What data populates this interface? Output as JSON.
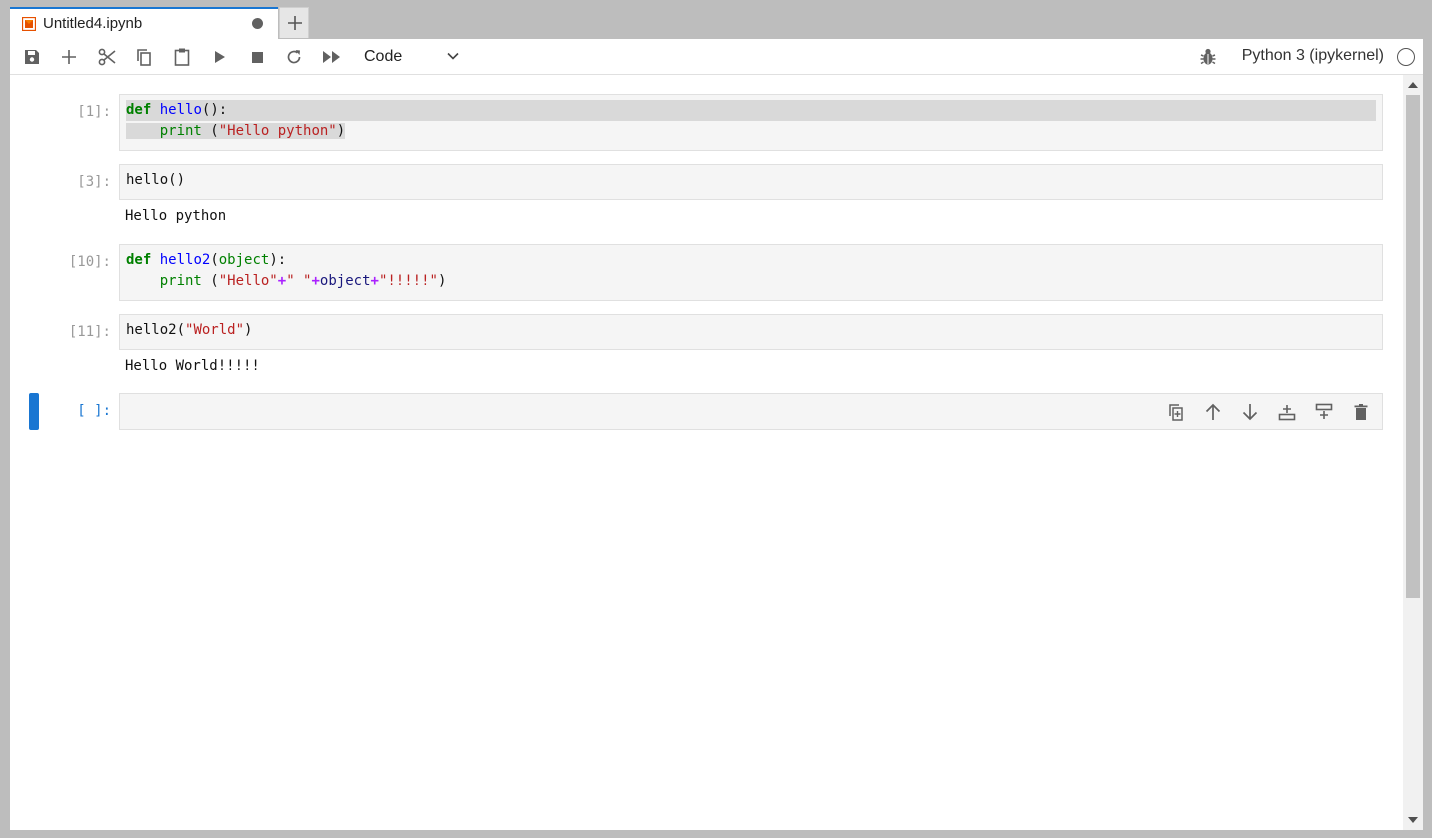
{
  "tab": {
    "title": "Untitled4.ipynb",
    "dirty": true,
    "new_tab": "+"
  },
  "toolbar": {
    "buttons": [
      "save-icon",
      "add-cell-icon",
      "cut-icon",
      "copy-icon",
      "paste-icon",
      "run-icon",
      "stop-icon",
      "restart-icon",
      "run-all-icon"
    ],
    "cell_type": "Code",
    "kernel": "Python 3 (ipykernel)"
  },
  "cells": [
    {
      "prompt": "[1]:",
      "code_lines": [
        "def hello():",
        "    print (\"Hello python\")"
      ],
      "selected": true
    },
    {
      "prompt": "[3]:",
      "code_lines": [
        "hello()"
      ],
      "output": "Hello python"
    },
    {
      "prompt": "[10]:",
      "code_lines": [
        "def hello2(object):",
        "    print (\"Hello\"+\" \"+object+\"!!!!!\")"
      ]
    },
    {
      "prompt": "[11]:",
      "code_lines": [
        "hello2(\"World\")"
      ],
      "output": "Hello World!!!!!"
    },
    {
      "prompt": "[ ]:",
      "code_lines": [
        ""
      ],
      "active": true
    }
  ],
  "tokens": {
    "c1_def": "def",
    "c1_name": "hello",
    "c1_paren": "():",
    "c1_print": "print",
    "c1_open": " (",
    "c1_str": "\"Hello python\"",
    "c1_close": ")",
    "c2_call": "hello()",
    "c3_def": "def",
    "c3_name": "hello2",
    "c3_open": "(",
    "c3_arg": "object",
    "c3_close": "):",
    "c3_print": "print",
    "c3_p_open": " (",
    "c3_s1": "\"Hello\"",
    "c3_op1": "+",
    "c3_s2": "\" \"",
    "c3_op2": "+",
    "c3_var": "object",
    "c3_op3": "+",
    "c3_s3": "\"!!!!!\"",
    "c3_p_close": ")",
    "c4_name": "hello2",
    "c4_open": "(",
    "c4_str": "\"World\"",
    "c4_close": ")"
  },
  "cell_tools": [
    "duplicate-cell-icon",
    "move-up-icon",
    "move-down-icon",
    "insert-above-icon",
    "insert-below-icon",
    "delete-cell-icon"
  ],
  "colors": {
    "accent": "#1976d2",
    "keyword": "#008000",
    "function": "#0000ff",
    "string": "#ba2121",
    "operator": "#aa22ff"
  }
}
